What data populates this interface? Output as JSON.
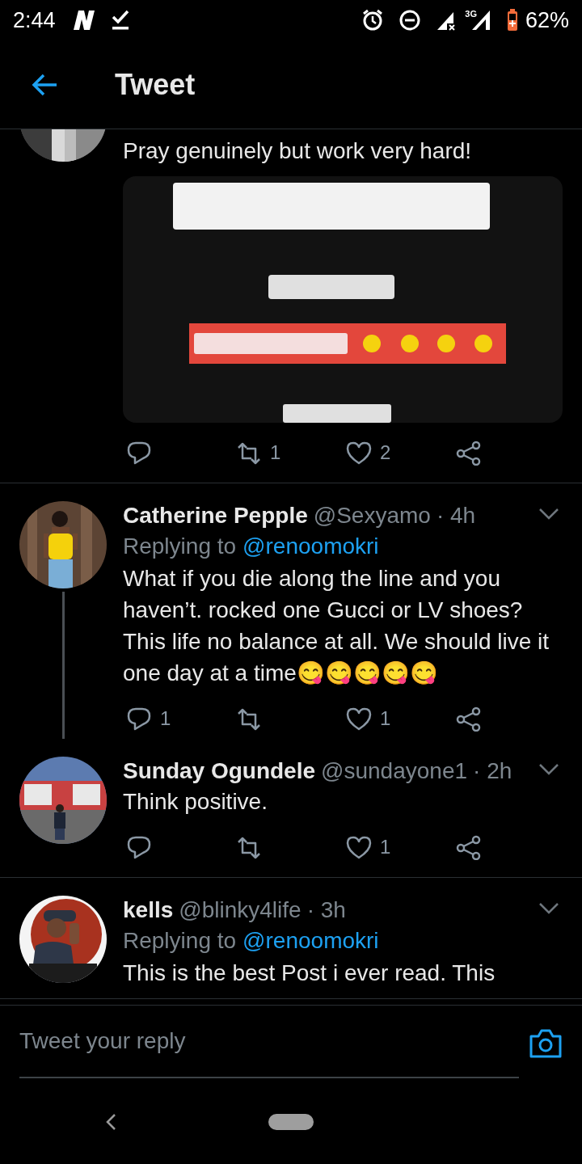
{
  "status_bar": {
    "time": "2:44",
    "network_label": "3G",
    "battery": "62%"
  },
  "header": {
    "title": "Tweet"
  },
  "tweets": [
    {
      "body": "Pray genuinely but work very hard!",
      "thread_line": false,
      "actions": {
        "retweets": "1",
        "likes": "2"
      }
    },
    {
      "name": "Catherine Pepple",
      "handle": "@Sexyamo",
      "time": "· 4h",
      "replying_label": "Replying to",
      "replying_to": "@renoomokri",
      "body": "What if you die along the line and you haven’t. rocked one Gucci or LV shoes? This life no balance at all. We should live it one day at a time😋😋😋😋😋",
      "thread_line": true,
      "actions": {
        "replies": "1",
        "likes": "1"
      }
    },
    {
      "name": "Sunday Ogundele",
      "handle": "@sundayone1",
      "time": "· 2h",
      "body": "Think positive.",
      "thread_line": false,
      "actions": {
        "likes": "1"
      }
    },
    {
      "name": "kells",
      "handle": "@blinky4life",
      "time": "· 3h",
      "replying_label": "Replying to",
      "replying_to": "@renoomokri",
      "body": "This is the best Post i ever read. This",
      "thread_line": false
    }
  ],
  "reply_bar": {
    "placeholder": "Tweet your reply"
  }
}
